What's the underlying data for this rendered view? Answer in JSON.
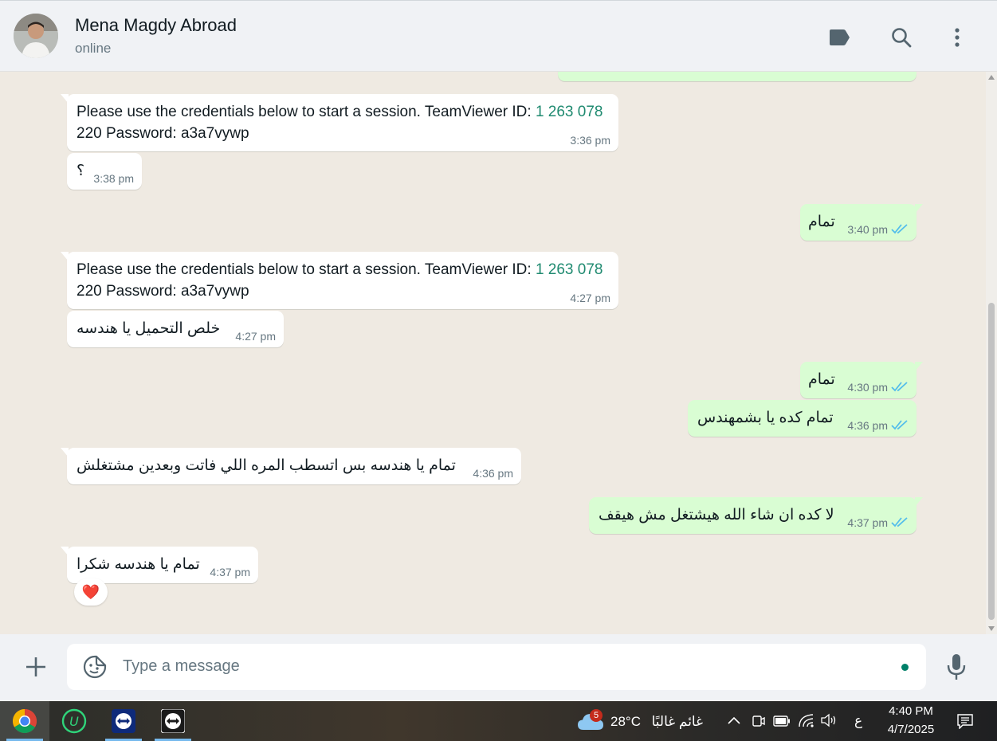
{
  "header": {
    "contact_name": "Mena Magdy Abroad",
    "status": "online",
    "icons": [
      "label-icon",
      "search-icon",
      "more-vertical-icon"
    ]
  },
  "messages": [
    {
      "dir": "in",
      "text_plain": "Please use the credentials below to start a session. TeamViewer ID: ",
      "text_link": "1 263 078",
      "text_line2": "220 Password: a3a7vywp",
      "time": "3:36 pm"
    },
    {
      "dir": "in",
      "text": "؟",
      "time": "3:38 pm"
    },
    {
      "dir": "out",
      "text": "تمام",
      "time": "3:40 pm"
    },
    {
      "dir": "in",
      "text_plain": "Please use the credentials below to start a session. TeamViewer ID: ",
      "text_link": "1 263 078",
      "text_line2": "220 Password: a3a7vywp",
      "time": "4:27 pm"
    },
    {
      "dir": "in",
      "text": "خلص التحميل يا هندسه",
      "time": "4:27 pm"
    },
    {
      "dir": "out",
      "text": "تمام",
      "time": "4:30 pm"
    },
    {
      "dir": "out",
      "text": "تمام كده يا بشمهندس",
      "time": "4:36 pm"
    },
    {
      "dir": "in",
      "text": "تمام يا هندسه بس اتسطب المره اللي فاتت وبعدين مشتغلش",
      "time": "4:36 pm"
    },
    {
      "dir": "out",
      "text": "لا كده ان شاء الله هيشتغل مش هيقف",
      "time": "4:37 pm"
    },
    {
      "dir": "in",
      "text": "تمام يا هندسه شكرا",
      "time": "4:37 pm",
      "reaction": "❤️"
    }
  ],
  "composer": {
    "placeholder": "Type a message",
    "status_dot_color": "#008069"
  },
  "taskbar": {
    "apps": [
      "chrome-icon",
      "upwork-icon",
      "teamviewer-icon",
      "teamviewer-icon"
    ],
    "weather_badge": "5",
    "temperature": "28°C",
    "weather_text": "غائم غالبًا",
    "input_language": "ع",
    "time": "4:40 PM",
    "date": "4/7/2025"
  },
  "colors": {
    "outgoing_bubble": "#d9fdd3",
    "incoming_bubble": "#ffffff",
    "chat_background": "#efeae2",
    "read_ticks": "#53bdeb",
    "link": "#1f8a70"
  }
}
